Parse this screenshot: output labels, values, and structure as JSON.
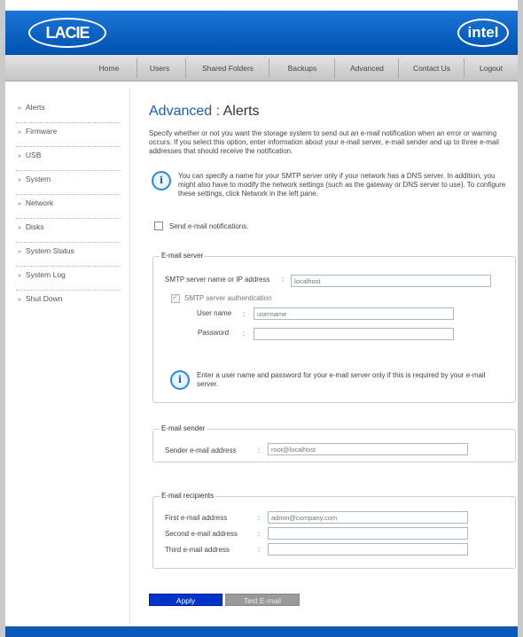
{
  "brand": {
    "left_logo": "LACIE",
    "right_logo": "intel"
  },
  "nav": {
    "items": [
      "Home",
      "Users",
      "Shared Folders",
      "Backups",
      "Advanced",
      "Contact Us",
      "Logout"
    ]
  },
  "sidebar": {
    "items": [
      "Alerts",
      "Firmware",
      "USB",
      "System",
      "Network",
      "Disks",
      "System Status",
      "System Log",
      "Shut Down"
    ]
  },
  "page": {
    "title_main": "Advanced",
    "title_sep": " : ",
    "title_sub": "Alerts",
    "intro": "Specify whether or not you want the storage system to send out an e-mail notification when an error or warning occurs. If you select this option, enter information about your e-mail server, e-mail sender and up to three e-mail addresses that should receive the notification.",
    "info_dns": "You can specify a name for your SMTP server only if your network has a DNS server. In addition, you might also have to modify the network settings (such as the gateway or DNS server to use). To configure these settings, click Network in the left pane.",
    "send_notifications_label": "Send e-mail notifications."
  },
  "email_server": {
    "legend": "E-mail server",
    "smtp_label": "SMTP server name or IP address",
    "colon": ":",
    "smtp_placeholder": "localhost",
    "auth_label": "SMTP server authentication",
    "username_label": "User name",
    "username_placeholder": "username",
    "password_label": "Password",
    "info_auth": "Enter a user name and password for your e-mail server only if this is required by your e-mail server."
  },
  "email_sender": {
    "legend": "E-mail sender",
    "sender_label": "Sender e-mail address",
    "sender_placeholder": "root@localhost"
  },
  "email_recipients": {
    "legend": "E-mail recipients",
    "first_label": "First e-mail address",
    "first_placeholder": "admin@company.com",
    "second_label": "Second e-mail address",
    "third_label": "Third e-mail address"
  },
  "buttons": {
    "apply": "Apply",
    "test": "Test E-mail"
  },
  "colors": {
    "header_blue": "#0a63c4",
    "title_blue": "#1a5fb4",
    "apply_blue": "#0033cc"
  }
}
